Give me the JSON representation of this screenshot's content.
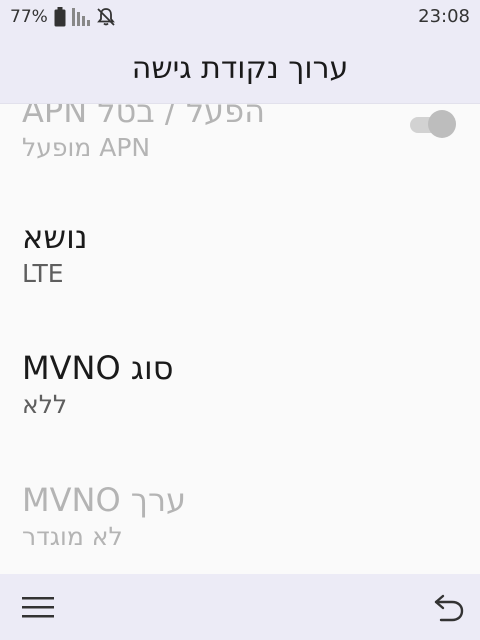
{
  "status_bar": {
    "battery_percent": "77%",
    "time": "23:08",
    "icons": [
      "battery-icon",
      "signal-icon",
      "notifications-off-icon"
    ]
  },
  "header": {
    "title": "ערוך נקודת גישה"
  },
  "settings": {
    "apn_enable": {
      "title": "הפעל / בטל APN",
      "summary": "APN מופעל",
      "toggle_on": true
    },
    "bearer": {
      "title": "נושא",
      "summary": "LTE"
    },
    "mvno_type": {
      "title": "סוג MVNO",
      "summary": "ללא"
    },
    "mvno_value": {
      "title": "ערך MVNO",
      "summary": "לא מוגדר"
    }
  },
  "bottom_bar": {
    "icons": [
      "menu-icon",
      "back-icon"
    ]
  },
  "colors": {
    "bar_background": "#ecebf6",
    "content_background": "#fafafa",
    "disabled_text": "#b4b4b4"
  }
}
